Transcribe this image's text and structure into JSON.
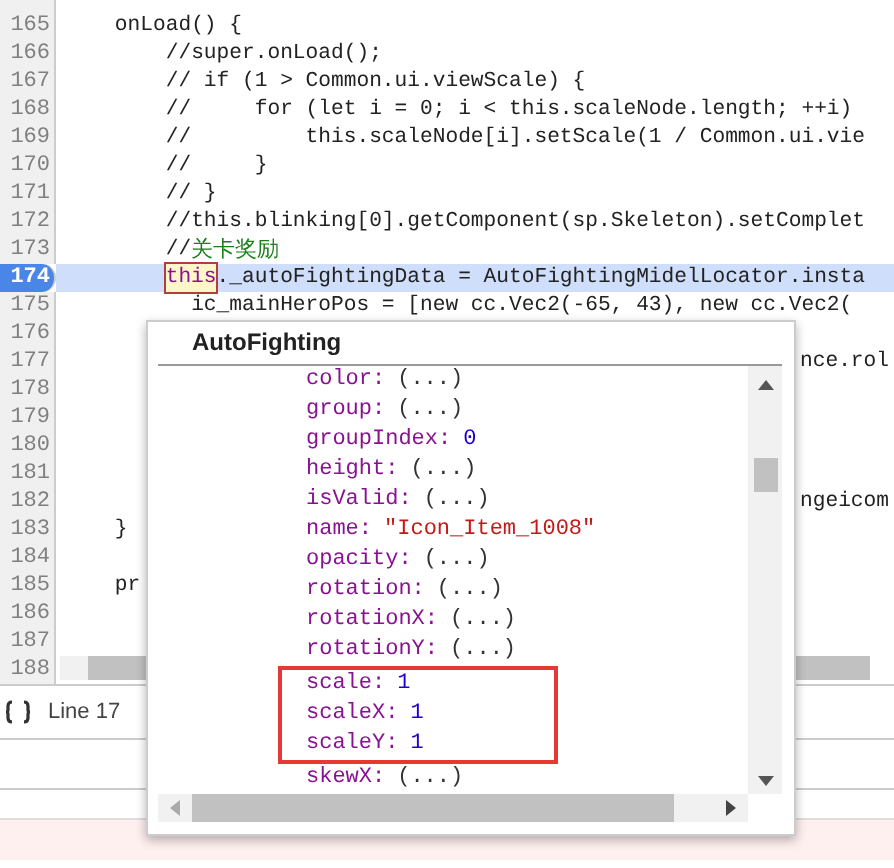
{
  "editor": {
    "lines": [
      {
        "number": "165",
        "text": "    onLoad() {",
        "selected": false
      },
      {
        "number": "166",
        "text": "        //super.onLoad();",
        "selected": false
      },
      {
        "number": "167",
        "text": "        // if (1 > Common.ui.viewScale) {",
        "selected": false
      },
      {
        "number": "168",
        "text": "        //     for (let i = 0; i < this.scaleNode.length; ++i)",
        "selected": false
      },
      {
        "number": "169",
        "text": "        //         this.scaleNode[i].setScale(1 / Common.ui.vie",
        "selected": false
      },
      {
        "number": "170",
        "text": "        //     }",
        "selected": false
      },
      {
        "number": "171",
        "text": "        // }",
        "selected": false
      },
      {
        "number": "172",
        "text": "        //this.blinking[0].getComponent(sp.Skeleton).setComplet",
        "selected": false
      },
      {
        "number": "173",
        "text": "        //",
        "comment": "关卡奖励",
        "selected": false
      },
      {
        "number": "174",
        "marked": "this",
        "rest": "._autoFightingData = AutoFightingMidelLocator.insta",
        "selected": true
      },
      {
        "number": "175",
        "text": "          ic_mainHeroPos = [new cc.Vec2(-65, 43), new cc.Vec2(",
        "selected": false
      },
      {
        "number": "176",
        "selected": false
      },
      {
        "number": "177",
        "tail": "nce.rol",
        "selected": false
      },
      {
        "number": "178",
        "selected": false
      },
      {
        "number": "179",
        "selected": false
      },
      {
        "number": "180",
        "selected": false
      },
      {
        "number": "181",
        "selected": false
      },
      {
        "number": "182",
        "tail": "ngeicom",
        "selected": false
      },
      {
        "number": "183",
        "text": "    }",
        "selected": false
      },
      {
        "number": "184",
        "selected": false
      },
      {
        "number": "185",
        "text": "    pr",
        "selected": false
      },
      {
        "number": "186",
        "selected": false
      },
      {
        "number": "187",
        "selected": false
      },
      {
        "number": "188",
        "selected": false
      }
    ]
  },
  "status_bar": {
    "position": "Line 17"
  },
  "tooltip": {
    "title": "AutoFighting",
    "properties": [
      {
        "key": "color:",
        "value": "(...)",
        "kind": "getter",
        "highlighted": false
      },
      {
        "key": "group:",
        "value": "(...)",
        "kind": "getter",
        "highlighted": false
      },
      {
        "key": "groupIndex:",
        "value": "0",
        "kind": "number",
        "highlighted": false
      },
      {
        "key": "height:",
        "value": "(...)",
        "kind": "getter",
        "highlighted": false
      },
      {
        "key": "isValid:",
        "value": "(...)",
        "kind": "getter",
        "highlighted": false
      },
      {
        "key": "name:",
        "value": "\"Icon_Item_1008\"",
        "kind": "string",
        "highlighted": false
      },
      {
        "key": "opacity:",
        "value": "(...)",
        "kind": "getter",
        "highlighted": false
      },
      {
        "key": "rotation:",
        "value": "(...)",
        "kind": "getter",
        "highlighted": false
      },
      {
        "key": "rotationX:",
        "value": "(...)",
        "kind": "getter",
        "highlighted": false
      },
      {
        "key": "rotationY:",
        "value": "(...)",
        "kind": "getter",
        "highlighted": false
      },
      {
        "key": "scale:",
        "value": "1",
        "kind": "number",
        "highlighted": true
      },
      {
        "key": "scaleX:",
        "value": "1",
        "kind": "number",
        "highlighted": true
      },
      {
        "key": "scaleY:",
        "value": "1",
        "kind": "number",
        "highlighted": true
      },
      {
        "key": "skewX:",
        "value": "(...)",
        "kind": "getter",
        "highlighted": false
      }
    ]
  }
}
